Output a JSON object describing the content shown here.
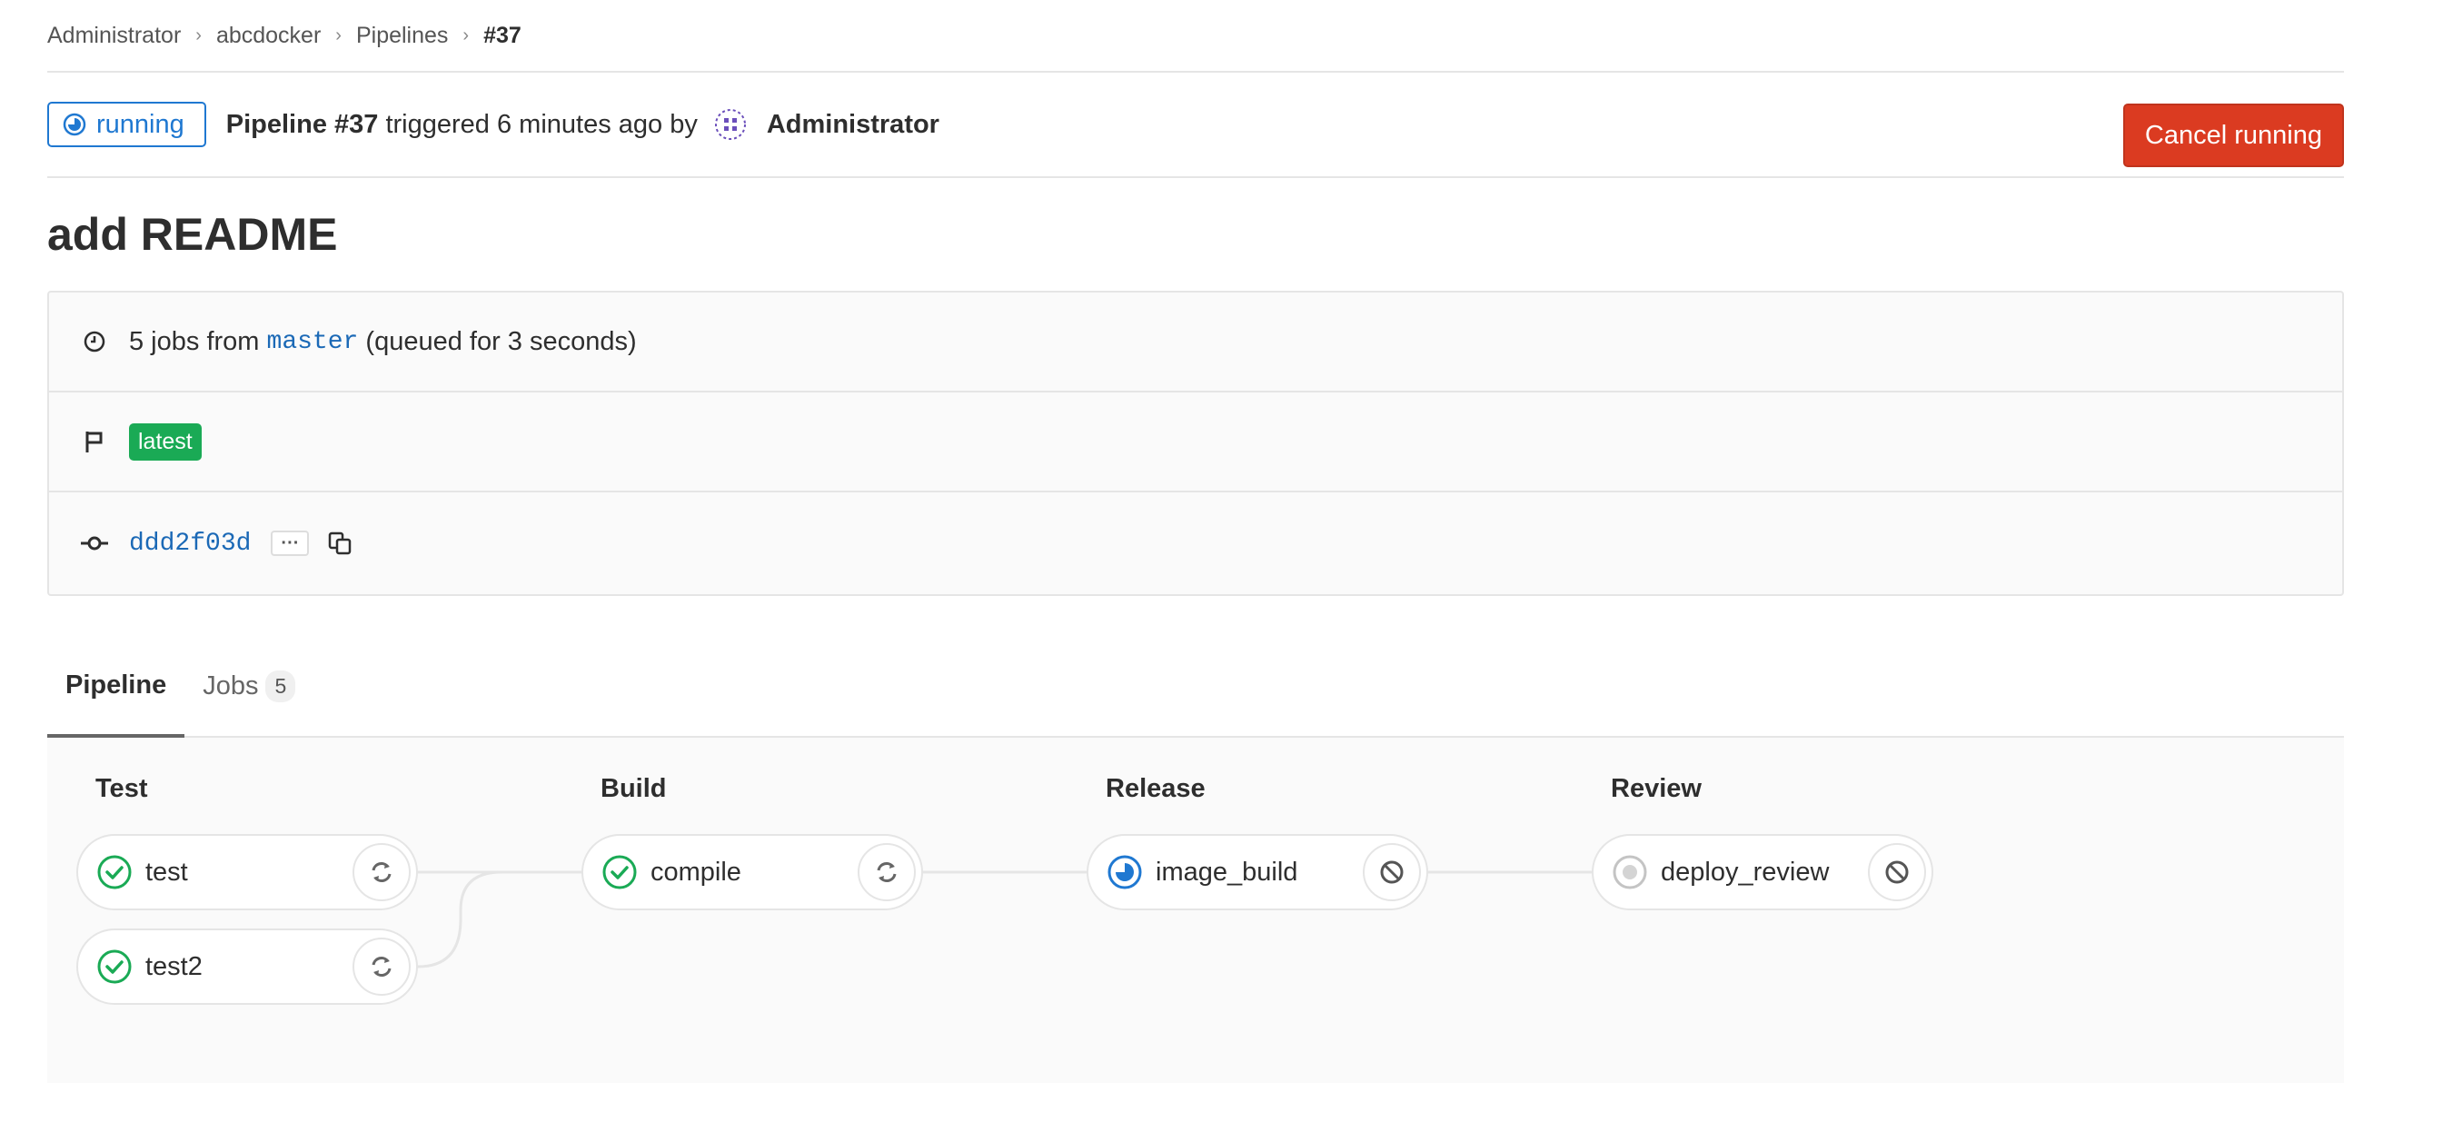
{
  "breadcrumb": [
    "Administrator",
    "abcdocker",
    "Pipelines",
    "#37"
  ],
  "header": {
    "status": "running",
    "pipeline_label": "Pipeline #37",
    "triggered_text": "triggered 6 minutes ago by",
    "user": "Administrator",
    "cancel_label": "Cancel running"
  },
  "title": "add README",
  "info": {
    "jobs_text": "5 jobs from",
    "branch": "master",
    "queued_text": "(queued for 3 seconds)",
    "badge": "latest",
    "sha": "ddd2f03d",
    "ellipsis": "···"
  },
  "tabs": [
    {
      "label": "Pipeline",
      "active": true
    },
    {
      "label": "Jobs",
      "count": "5"
    }
  ],
  "stages": [
    {
      "name": "Test",
      "jobs": [
        {
          "name": "test",
          "status": "success",
          "action": "retry-icon"
        },
        {
          "name": "test2",
          "status": "success",
          "action": "retry-icon"
        }
      ]
    },
    {
      "name": "Build",
      "jobs": [
        {
          "name": "compile",
          "status": "success",
          "action": "retry-icon"
        }
      ]
    },
    {
      "name": "Release",
      "jobs": [
        {
          "name": "image_build",
          "status": "running",
          "action": "cancel-icon"
        }
      ]
    },
    {
      "name": "Review",
      "jobs": [
        {
          "name": "deploy_review",
          "status": "created",
          "action": "cancel-icon"
        }
      ]
    }
  ],
  "colors": {
    "running": "#1f78d1",
    "success": "#1aaa55",
    "danger": "#db3b21",
    "link": "#1b69b6"
  }
}
